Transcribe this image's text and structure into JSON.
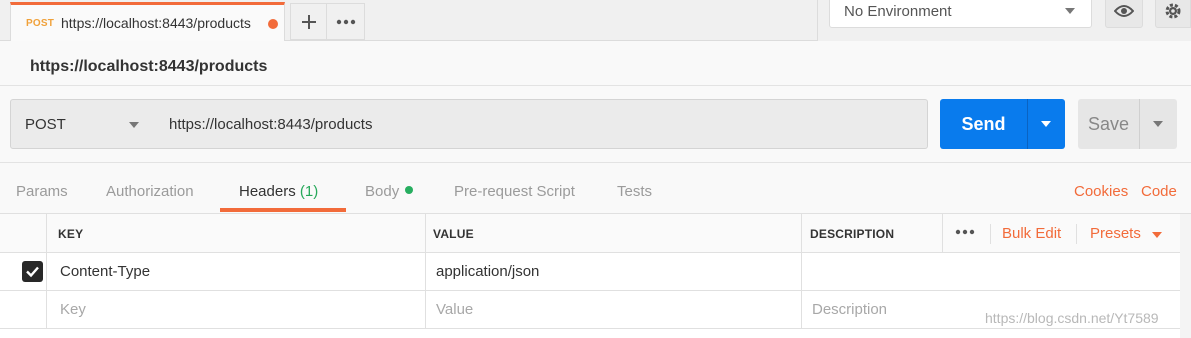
{
  "request_tab": {
    "method": "POST",
    "title": "https://localhost:8443/products"
  },
  "environment": {
    "selected": "No Environment"
  },
  "request_name": "https://localhost:8443/products",
  "url_bar": {
    "method": "POST",
    "url": "https://localhost:8443/products",
    "send_label": "Send",
    "save_label": "Save"
  },
  "subtabs": {
    "params": "Params",
    "authorization": "Authorization",
    "headers": "Headers",
    "headers_count": "(1)",
    "body": "Body",
    "prerequest": "Pre-request Script",
    "tests": "Tests",
    "active": "Headers"
  },
  "right_links": {
    "cookies": "Cookies",
    "code": "Code"
  },
  "headers_table": {
    "columns": {
      "key": "KEY",
      "value": "VALUE",
      "description": "DESCRIPTION"
    },
    "bulk_edit": "Bulk Edit",
    "presets": "Presets",
    "rows": [
      {
        "checked": true,
        "key": "Content-Type",
        "value": "application/json",
        "description": ""
      }
    ],
    "placeholders": {
      "key": "Key",
      "value": "Value",
      "description": "Description"
    }
  },
  "watermark": "https://blog.csdn.net/Yt7589",
  "colors": {
    "accent": "#f26b3a",
    "send": "#097bed",
    "body_indicator": "#27ae60"
  },
  "icons": [
    "plus-icon",
    "more-icon",
    "eye-icon",
    "gear-icon",
    "check-icon",
    "caret-down-icon"
  ]
}
